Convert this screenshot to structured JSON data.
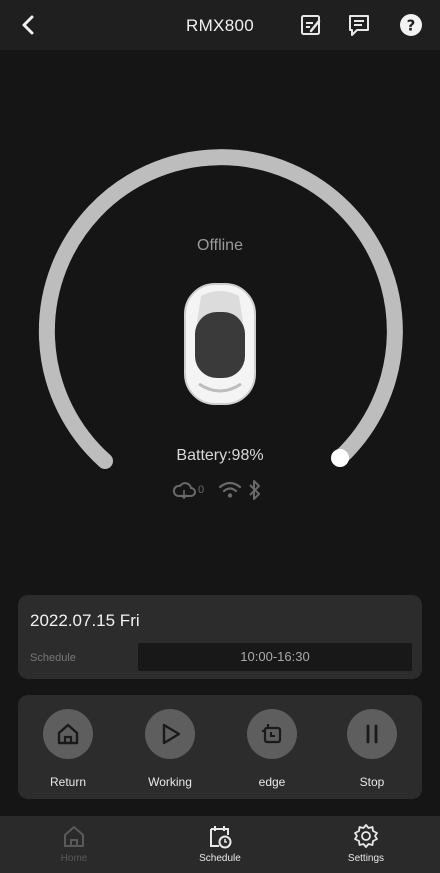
{
  "header": {
    "title": "RMX800"
  },
  "icons": {
    "back": "chevron-left-icon",
    "edit": "edit-note-icon",
    "message": "message-icon",
    "help": "help-icon"
  },
  "device": {
    "status": "Offline",
    "battery_text": "Battery:98%",
    "battery_level": 0.98,
    "cloud_count": "0"
  },
  "schedule": {
    "date": "2022.07.15 Fri",
    "label": "Schedule",
    "time": "10:00-16:30"
  },
  "actions": [
    {
      "label": "Return",
      "icon": "home-icon"
    },
    {
      "label": "Working",
      "icon": "play-icon"
    },
    {
      "label": "edge",
      "icon": "edge-icon"
    },
    {
      "label": "Stop",
      "icon": "pause-icon"
    }
  ],
  "nav": [
    {
      "label": "Home",
      "icon": "home-icon",
      "active": false
    },
    {
      "label": "Schedule",
      "icon": "calendar-clock-icon",
      "active": true
    },
    {
      "label": "Settings",
      "icon": "gear-icon",
      "active": true
    }
  ],
  "colors": {
    "background": "#151515",
    "card": "#2c2c2c",
    "gauge": "#bdbdbd",
    "action_circle": "#5e5e5e"
  }
}
